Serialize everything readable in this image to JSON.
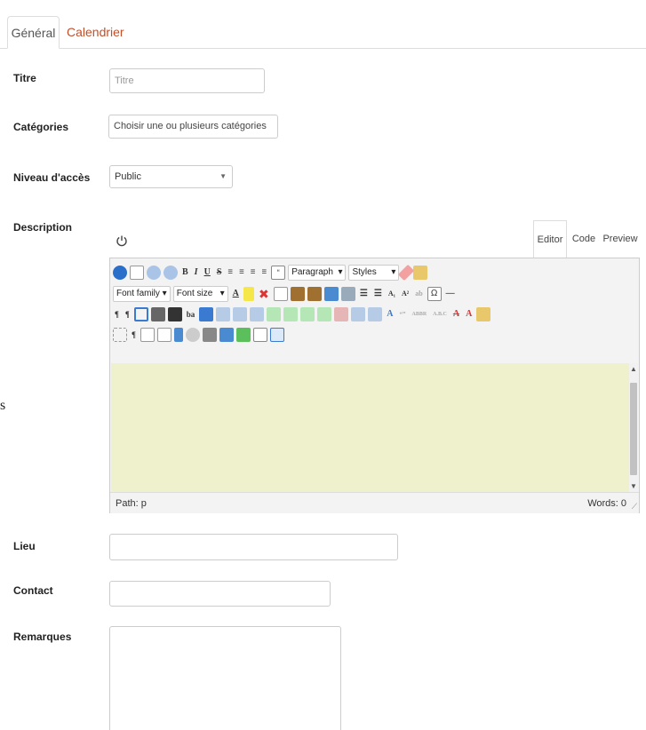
{
  "tabs": [
    {
      "label": "Général",
      "active": true
    },
    {
      "label": "Calendrier",
      "active": false
    }
  ],
  "fields": {
    "titre": {
      "label": "Titre",
      "placeholder": "Titre",
      "value": ""
    },
    "categories": {
      "label": "Catégories",
      "placeholder": "Choisir une ou plusieurs catégories"
    },
    "niveau": {
      "label": "Niveau d'accès",
      "value": "Public"
    },
    "description": {
      "label": "Description"
    },
    "lieu": {
      "label": "Lieu",
      "value": ""
    },
    "contact": {
      "label": "Contact",
      "value": ""
    },
    "remarques": {
      "label": "Remarques",
      "value": ""
    }
  },
  "editor": {
    "tabs": [
      "Editor",
      "Code",
      "Preview"
    ],
    "active_tab": "Editor",
    "paragraph": "Paragraph",
    "styles": "Styles",
    "font_family": "Font family",
    "font_size": "Font size",
    "path": "Path: p",
    "words": "Words: 0",
    "content_color": "#eff0cc"
  },
  "stray_text": "s",
  "colors": {
    "accent": "#c0502a"
  }
}
